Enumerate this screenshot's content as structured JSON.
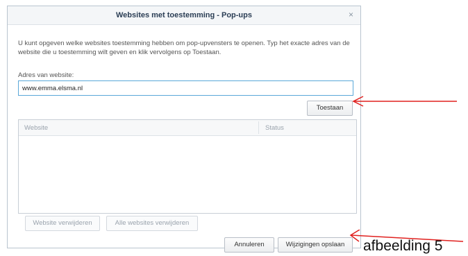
{
  "dialog": {
    "title": "Websites met toestemming - Pop-ups",
    "close_glyph": "×",
    "description": "U kunt opgeven welke websites toestemming hebben om pop-upvensters te openen. Typ het exacte adres van de website die u toestemming wilt geven en klik vervolgens op Toestaan.",
    "address_label": "Adres van website:",
    "address_value": "www.emma.elsma.nl",
    "allow_button": "Toestaan",
    "table": {
      "columns": [
        "Website",
        "Status"
      ],
      "rows": []
    },
    "remove_button": "Website verwijderen",
    "remove_all_button": "Alle websites verwijderen",
    "cancel_button": "Annuleren",
    "save_button": "Wijzigingen opslaan"
  },
  "annotation": {
    "caption": "afbeelding 5",
    "arrow_color": "#e0201e"
  }
}
